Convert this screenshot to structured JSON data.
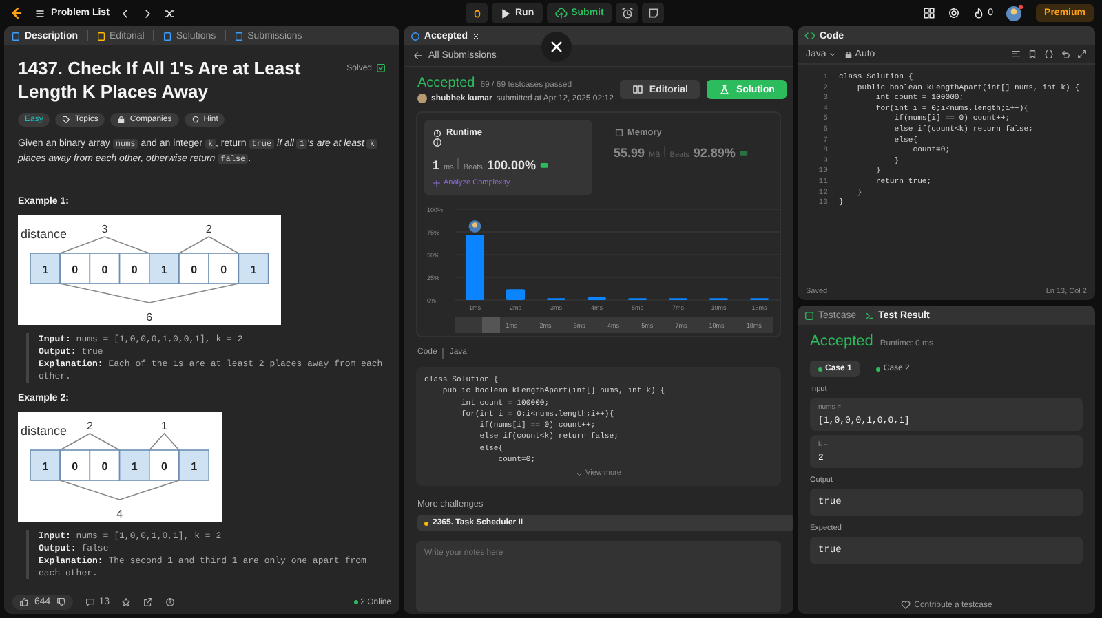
{
  "topbar": {
    "nav_title": "Problem List",
    "run": "Run",
    "submit": "Submit",
    "streak": "0",
    "premium": "Premium"
  },
  "problem": {
    "tabs": [
      {
        "label": "Description",
        "selected": true
      },
      {
        "label": "Editorial",
        "selected": false
      },
      {
        "label": "Solutions",
        "selected": false
      },
      {
        "label": "Submissions",
        "selected": false
      }
    ],
    "title": "1437. Check If All 1's Are at Least Length K Places Away",
    "status": "Solved",
    "difficulty": "Easy",
    "tags": [
      "Topics",
      "Companies",
      "Hint"
    ],
    "description": [
      {
        "kind": "text",
        "text": "Given an binary array "
      },
      {
        "kind": "code",
        "text": "nums"
      },
      {
        "kind": "text",
        "text": " and an integer "
      },
      {
        "kind": "code",
        "text": "k"
      },
      {
        "kind": "text",
        "text": ", return "
      },
      {
        "kind": "code",
        "text": "true"
      },
      {
        "kind": "italic",
        "text": " if all "
      },
      {
        "kind": "code",
        "text": "1"
      },
      {
        "kind": "italic",
        "text": "'s are at least "
      },
      {
        "kind": "code",
        "text": "k"
      },
      {
        "kind": "italic",
        "text": " places away from each other, otherwise return "
      },
      {
        "kind": "code",
        "text": "false"
      },
      {
        "kind": "text",
        "text": "."
      }
    ],
    "examples": [
      {
        "title": "Example 1:",
        "diagram": {
          "label": "distance",
          "cells": [
            {
              "value": "1",
              "highlighted": true
            },
            {
              "value": "0",
              "highlighted": false
            },
            {
              "value": "0",
              "highlighted": false
            },
            {
              "value": "0",
              "highlighted": false
            },
            {
              "value": "1",
              "highlighted": true
            },
            {
              "value": "0",
              "highlighted": false
            },
            {
              "value": "0",
              "highlighted": false
            },
            {
              "value": "1",
              "highlighted": true
            }
          ],
          "gaps": [
            "3",
            "2"
          ],
          "total": "6"
        },
        "lines": [
          "**Input:** nums = [1,0,0,0,1,0,0,1], k = 2",
          "**Output:** true",
          "**Explanation:** Each of the 1s are at least 2 places away from each other."
        ]
      },
      {
        "title": "Example 2:",
        "diagram": {
          "label": "distance",
          "cells": [
            {
              "value": "1",
              "highlighted": true
            },
            {
              "value": "0",
              "highlighted": false
            },
            {
              "value": "0",
              "highlighted": false
            },
            {
              "value": "1",
              "highlighted": true
            },
            {
              "value": "0",
              "highlighted": false
            },
            {
              "value": "1",
              "highlighted": true
            }
          ],
          "gaps": [
            "2",
            "1"
          ],
          "total": "4"
        },
        "lines": [
          "**Input:** nums = [1,0,0,1,0,1], k = 2",
          "**Output:** false",
          "**Explanation:** The second 1 and third 1 are only one apart from each other."
        ]
      }
    ],
    "footer": {
      "likes": "644",
      "comments": "13",
      "online": "2 Online"
    }
  },
  "submission": {
    "tab": "Accepted",
    "back": "All Submissions",
    "status": "Accepted",
    "testcases": "69 / 69 testcases passed",
    "user": "shubhek kumar",
    "submitted": "submitted at Apr 12, 2025 02:12",
    "editorial": "Editorial",
    "solution": "Solution",
    "stats": [
      {
        "title": "Runtime",
        "value": "1",
        "unit": "ms",
        "beats_label": "Beats",
        "beats": "100.00%",
        "selected": true,
        "link": "Analyze Complexity"
      },
      {
        "title": "Memory",
        "value": "55.99",
        "unit": "MB",
        "beats_label": "Beats",
        "beats": "92.89%",
        "selected": false
      }
    ],
    "chart_data": {
      "type": "bar",
      "categories": [
        "1ms",
        "2ms",
        "3ms",
        "4ms",
        "5ms",
        "7ms",
        "10ms",
        "18ms"
      ],
      "values": [
        72,
        12,
        2,
        3,
        2,
        2,
        2,
        2
      ],
      "grid": true,
      "ylim": [
        0,
        100
      ],
      "yticks": [
        {
          "value": 0,
          "label": "0%"
        },
        {
          "value": 25,
          "label": "25%"
        },
        {
          "value": 50,
          "label": "50%"
        },
        {
          "value": 75,
          "label": "75%"
        },
        {
          "value": 100,
          "label": "100%"
        }
      ]
    },
    "navigator_labels": [
      "1ms",
      "2ms",
      "3ms",
      "4ms",
      "5ms",
      "7ms",
      "10ms",
      "18ms"
    ],
    "code_label": "Code",
    "code_lang": "Java",
    "code": [
      "class Solution {",
      "    public boolean kLengthApart(int[] nums, int k) {",
      "        int count = 100000;",
      "        for(int i = 0;i<nums.length;i++){",
      "            if(nums[i] == 0) count++;",
      "            else if(count<k) return false;",
      "            else{",
      "                count=0;"
    ],
    "view_more": "View more",
    "more_title": "More challenges",
    "challenges": [
      "2365. Task Scheduler II"
    ],
    "notes": {
      "placeholder": "Write your notes here"
    }
  },
  "editor": {
    "title": "Code",
    "language": "Java",
    "mode": "Auto",
    "lines": [
      {
        "number": "1",
        "text": "class Solution {"
      },
      {
        "number": "2",
        "text": "    public boolean kLengthApart(int[] nums, int k) {"
      },
      {
        "number": "3",
        "text": "        int count = 100000;"
      },
      {
        "number": "4",
        "text": "        for(int i = 0;i<nums.length;i++){"
      },
      {
        "number": "5",
        "text": "            if(nums[i] == 0) count++;"
      },
      {
        "number": "6",
        "text": "            else if(count<k) return false;"
      },
      {
        "number": "7",
        "text": "            else{"
      },
      {
        "number": "8",
        "text": "                count=0;"
      },
      {
        "number": "9",
        "text": "            }"
      },
      {
        "number": "10",
        "text": "        }"
      },
      {
        "number": "11",
        "text": "        return true;"
      },
      {
        "number": "12",
        "text": "    }"
      },
      {
        "number": "13",
        "text": "}"
      }
    ],
    "saved": "Saved",
    "position": "Ln 13, Col 2"
  },
  "tests": {
    "tabs": [
      {
        "label": "Testcase",
        "selected": false
      },
      {
        "label": "Test Result",
        "selected": true
      }
    ],
    "status": "Accepted",
    "runtime": "Runtime: 0 ms",
    "cases": [
      {
        "label": "Case 1",
        "selected": true
      },
      {
        "label": "Case 2",
        "selected": false
      }
    ],
    "input_label": "Input",
    "inputs": [
      {
        "name": "nums =",
        "value": "[1,0,0,0,1,0,0,1]"
      },
      {
        "name": "k =",
        "value": "2"
      }
    ],
    "output_label": "Output",
    "output": "true",
    "expected_label": "Expected",
    "expected": "true",
    "contribute": "Contribute a testcase"
  }
}
